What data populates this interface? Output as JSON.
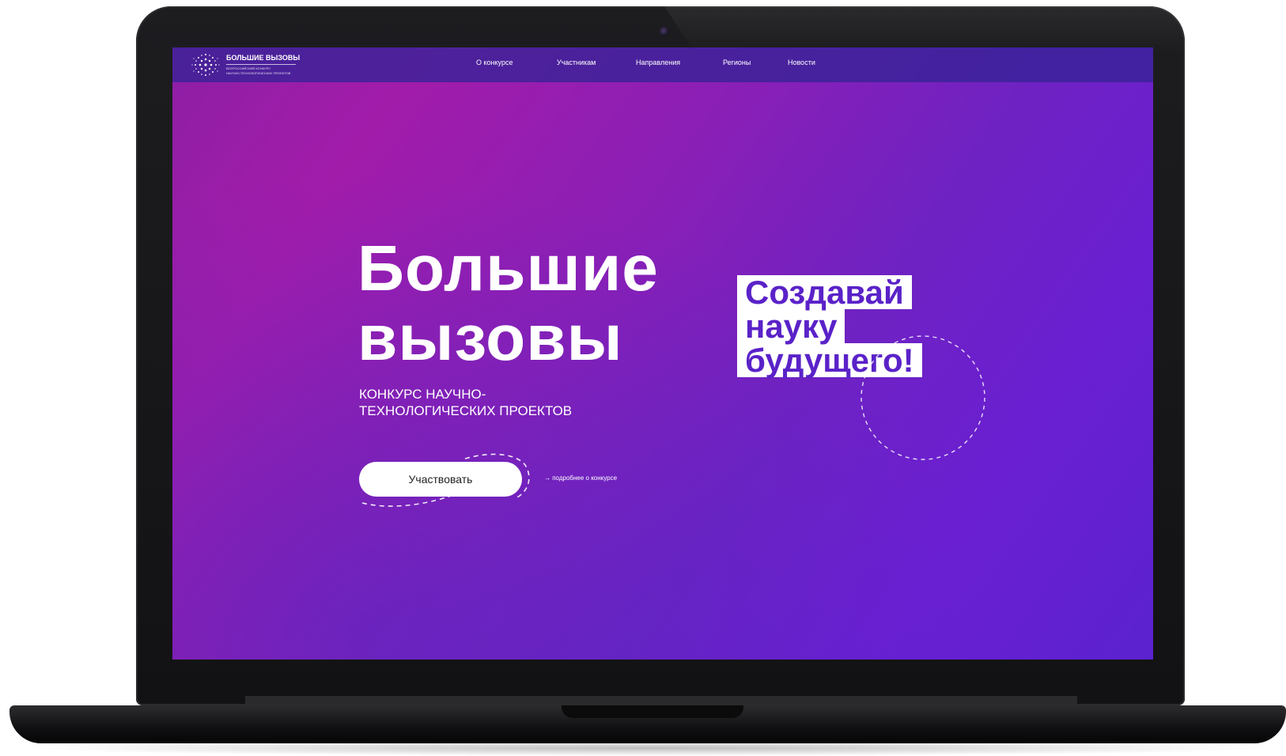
{
  "header": {
    "logo_title": "БОЛЬШИЕ ВЫЗОВЫ",
    "logo_sub_line1": "ВСЕРОССИЙСКИЙ КОНКУРС",
    "logo_sub_line2": "НАУЧНО-ТЕХНОЛОГИЧЕСКИХ ПРОЕКТОВ",
    "nav": [
      {
        "label": "О конкурсе"
      },
      {
        "label": "Участникам"
      },
      {
        "label": "Направления"
      },
      {
        "label": "Регионы"
      },
      {
        "label": "Новости"
      }
    ]
  },
  "hero": {
    "title_line1": "Большие",
    "title_line2": "вызовы",
    "subtitle_line1": "КОНКУРС НАУЧНО-",
    "subtitle_line2": "ТЕХНОЛОГИЧЕСКИХ ПРОЕКТОВ",
    "cta_label": "Участвовать",
    "more_link": "→ подробнее о конкурсе"
  },
  "slogan": {
    "line1": "Создавай",
    "line2": "науку",
    "line3": "будущего!"
  },
  "colors": {
    "accent": "#5a22c8",
    "header_bg": "#362296",
    "gradient_start": "#a21caa",
    "gradient_end": "#5b22cf",
    "device_body": "#151517"
  },
  "icons": {
    "logo": "dot-burst-logo-icon",
    "camera": "webcam-icon"
  }
}
